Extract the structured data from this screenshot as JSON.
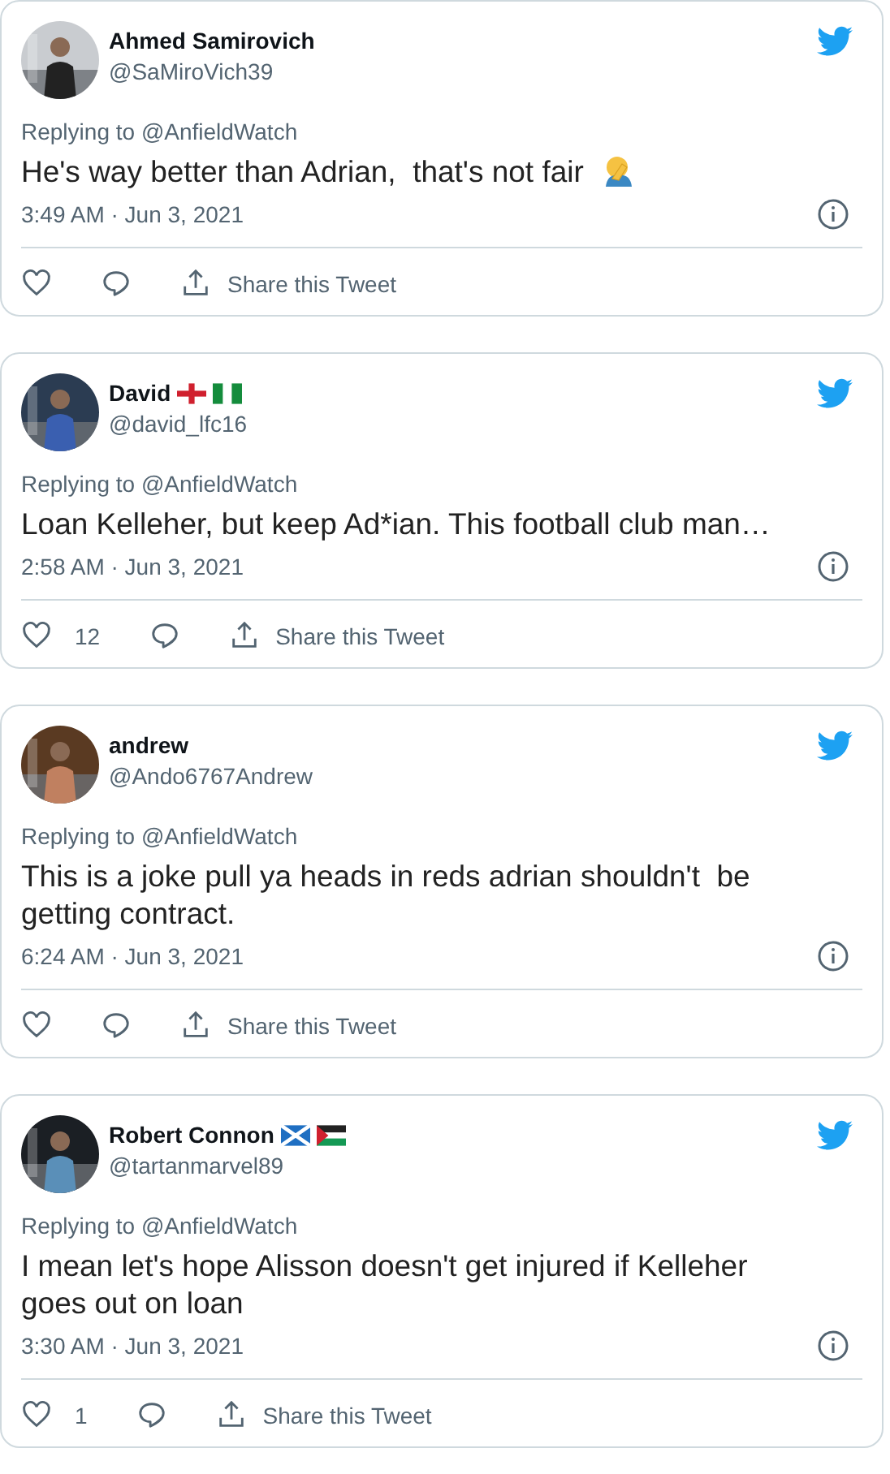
{
  "tweets": [
    {
      "name": "Ahmed Samirovich",
      "handle": "@SaMiroVich39",
      "replying_label": "Replying to",
      "replying_to": "@AnfieldWatch",
      "text": "He's way better than Adrian,  that's not fair",
      "emoji": {
        "kind": "facepalm"
      },
      "time": "3:49 AM · Jun 3, 2021",
      "share": "Share this Tweet"
    },
    {
      "name": "David",
      "flags": [
        {
          "kind": "england"
        },
        {
          "kind": "nigeria"
        }
      ],
      "handle": "@david_lfc16",
      "replying_label": "Replying to",
      "replying_to": "@AnfieldWatch",
      "text": "Loan Kelleher, but keep Ad*ian. This football club man…",
      "time": "2:58 AM · Jun 3, 2021",
      "likes": "12",
      "share": "Share this Tweet"
    },
    {
      "name": "andrew",
      "handle": "@Ando6767Andrew",
      "replying_label": "Replying to",
      "replying_to": "@AnfieldWatch",
      "text": "This is a joke pull ya heads in reds adrian shouldn't  be getting contract.",
      "time": "6:24 AM · Jun 3, 2021",
      "share": "Share this Tweet"
    },
    {
      "name": "Robert Connon",
      "flags": [
        {
          "kind": "scotland"
        },
        {
          "kind": "palestine"
        }
      ],
      "handle": "@tartanmarvel89",
      "replying_label": "Replying to",
      "replying_to": "@AnfieldWatch",
      "text": "I mean let's hope Alisson doesn't get injured if Kelleher goes out on loan",
      "time": "3:30 AM · Jun 3, 2021",
      "likes": "1",
      "share": "Share this Tweet"
    }
  ]
}
